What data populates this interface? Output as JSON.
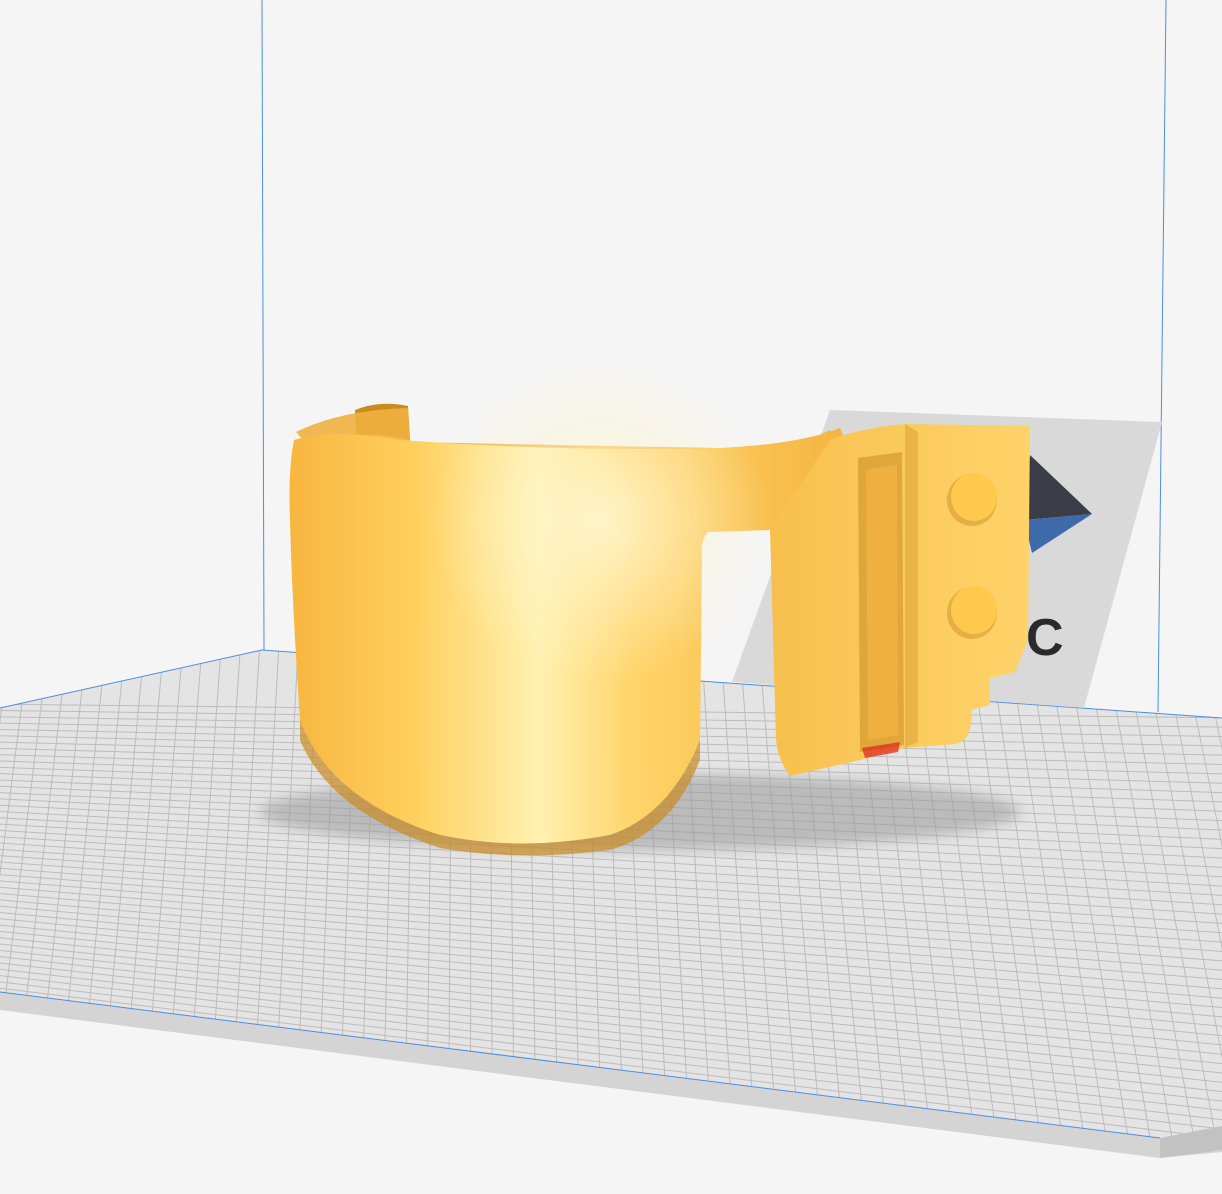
{
  "viewport": {
    "background_color": "#f5f5f5",
    "grid_color": "#bcbcbc",
    "plate_color": "#e4e4e4",
    "volume_edge_color": "#4a8fe0"
  },
  "model": {
    "color": "#ffc94d",
    "shadow_color": "#9a9a9a"
  },
  "logo": {
    "text": "C",
    "panel_color": "#d9d9d9",
    "arrow_dark_color": "#3a3d45",
    "arrow_blue_color": "#3f6aaa"
  }
}
